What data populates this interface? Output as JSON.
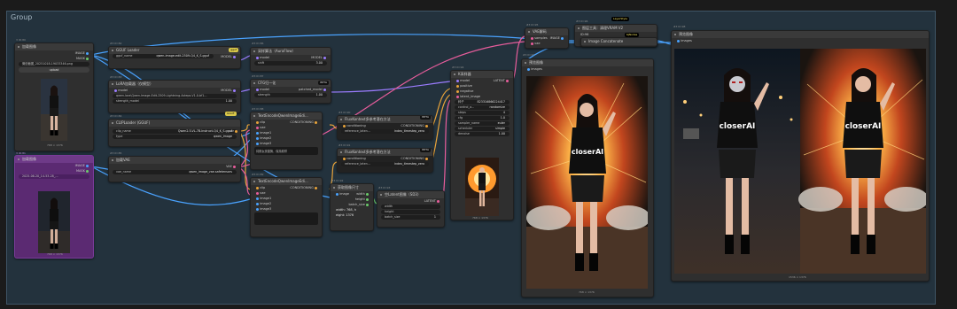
{
  "group": {
    "title": "Group"
  },
  "colors": {
    "link_blue": "#4aa3ff",
    "link_orange": "#e8a33a",
    "link_pink": "#e85d9c",
    "link_purple": "#9b7cff",
    "link_green": "#6acb6a"
  },
  "load_image": {
    "id": "3 ID:80",
    "title": "加载图像",
    "out_image": "IMAGE",
    "out_mask": "MASK",
    "file": "微信截图_20251018-19033346.png",
    "upload": "upload",
    "caption": "768 × 1376"
  },
  "load_image2": {
    "id": "3 ID:81",
    "title": "加载图像",
    "out_image": "IMAGE",
    "out_mask": "MASK",
    "file": "2025-06-20_14-53-28_...",
    "caption": "768 × 1376"
  },
  "gguf": {
    "id": "#3 ID:82",
    "badge": "gguf",
    "title": "GGUF Loader",
    "field_label": "gguf_name",
    "field_value": "qwen-image-edit-2509-Q4_K_S.gguf",
    "out": "MODEL"
  },
  "lora": {
    "id": "#3 ID:83",
    "title": "LoRA加载器（仅模型）",
    "in": "model",
    "out": "MODEL",
    "field1_value": "qwen-lora\\Qwen-Image-Edit-2509-Lightning-4steps-V1.0-bf1...",
    "field2_label": "strength_model",
    "field2_value": "1.00",
    "badge": "GGUF"
  },
  "clip": {
    "id": "#3 ID:84",
    "title": "CLIPLoader (GGUF)",
    "field1_label": "clip_name",
    "field1_value": "Qwen2.5-VL-7B-Instruct-Q4_K_S.gguf",
    "field2_label": "type",
    "field2_value": "qwen_image",
    "out": "CLIP"
  },
  "vae_loader": {
    "id": "#3 ID:85",
    "title": "加载VAE",
    "field_label": "vae_name",
    "field_value": "qwen_image_vae.safetensors",
    "out": "VAE"
  },
  "aura": {
    "id": "#3 ID:86",
    "title": "采样算法（AuraFlow）",
    "in": "model",
    "out": "MODEL",
    "field_label": "shift",
    "field_value": "3.00"
  },
  "cfg": {
    "id": "#3 ID:87",
    "title": "CFG归一化",
    "badge": "BETA",
    "in": "model",
    "out": "patched_model",
    "field_label": "strength",
    "field_value": "1.00"
  },
  "text_pos": {
    "id": "#3 ID:88",
    "title": "TextEncodeQwenImageEdi...",
    "ins": [
      "clip",
      "vae",
      "image1",
      "image2",
      "image3"
    ],
    "out": "CONDITIONING",
    "text": "将那女孩替换，保持原样"
  },
  "text_neg": {
    "id": "#3 ID:89",
    "title": "TextEncodeQwenImageEdi...",
    "ins": [
      "clip",
      "vae",
      "image1",
      "image2",
      "image3"
    ],
    "out": "CONDITIONING"
  },
  "flux1": {
    "id": "#3 ID:90",
    "title": "FluxKontext多参考潜在方法",
    "badge": "BETA",
    "in": "conditioning",
    "out": "CONDITIONING",
    "field_label": "reference_laten...",
    "field_value": "index_timestep_zero"
  },
  "flux2": {
    "id": "#3 ID:91",
    "title": "FluxKontext多参考潜在方法",
    "badge": "BETA",
    "in": "conditioning",
    "out": "CONDITIONING",
    "field_label": "reference_laten...",
    "field_value": "index_timestep_zero"
  },
  "get_size": {
    "id": "#3 ID:92",
    "title": "获取图像尺寸",
    "in": "image",
    "outs": [
      "width",
      "height",
      "batch_size"
    ],
    "width_text": "width: 768, h",
    "height_text": "eight: 1376"
  },
  "empty_latent": {
    "id": "#3 ID:93",
    "title": "空Latent图像（SD3）",
    "out": "LATENT",
    "f1": "width",
    "f2": "height",
    "f3_label": "batch_size",
    "f3_value": "1"
  },
  "ksampler": {
    "id": "#3 ID:94",
    "title": "K采样器",
    "ins": [
      "model",
      "positive",
      "negative",
      "latent_image"
    ],
    "out": "LATENT",
    "fields": [
      {
        "label": "种子",
        "value": "823316866224417"
      },
      {
        "label": "control_a...",
        "value": "randomize"
      },
      {
        "label": "steps",
        "value": "4"
      },
      {
        "label": "cfg",
        "value": "1.0"
      },
      {
        "label": "sampler_name",
        "value": "euler"
      },
      {
        "label": "scheduler",
        "value": "simple"
      },
      {
        "label": "denoise",
        "value": "1.00"
      }
    ],
    "caption": "768 × 1376"
  },
  "vae_decode": {
    "id": "#3 ID:95",
    "title": "VAE解码",
    "ins": [
      "samples",
      "vae"
    ],
    "out": "IMAGE"
  },
  "layer_util": {
    "id": "#3 ID:96",
    "title": "图层工具：清理VRAM V2",
    "badge_top": "LayerStyle",
    "badge_bot": "KJNodes",
    "field_label": "ID:96"
  },
  "concat": {
    "title": "Image Concatenate"
  },
  "preview1": {
    "id": "#3 ID:97",
    "title": "预览图像",
    "in": "images",
    "caption": "768 × 1376",
    "shirt_text": "closerAI"
  },
  "preview2": {
    "id": "#3 ID:98",
    "title": "预览图像",
    "in": "images",
    "caption": "1536 × 1376",
    "shirt_text": "closerAI"
  }
}
